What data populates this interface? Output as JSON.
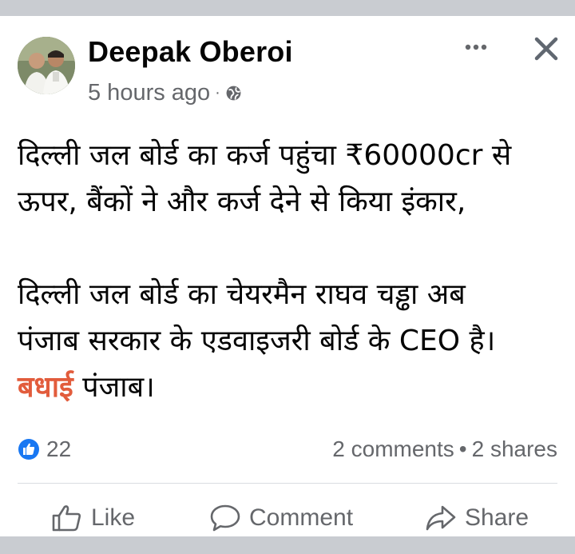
{
  "post": {
    "author": "Deepak Oberoi",
    "timestamp": "5 hours ago",
    "separator": "·",
    "privacy_icon": "globe-icon",
    "menu_icon": "more-icon",
    "close_icon": "close-icon",
    "lines": [
      "दिल्ली जल बोर्ड का कर्ज पहुंचा ₹60000cr से",
      "ऊपर, बैंकों ने और कर्ज देने से किया इंकार,",
      "दिल्ली जल बोर्ड का चेयरमैन राघव चड्ढा अब",
      "पंजाब सरकार के एडवाइजरी बोर्ड के CEO है।"
    ],
    "highlight_word": "बधाई",
    "last_line_rest": " पंजाब।",
    "highlight_color": "#e25c3c"
  },
  "engagement": {
    "reaction_count": "22",
    "comments": "2 comments",
    "dot": "•",
    "shares": "2 shares"
  },
  "actions": {
    "like_label": "Like",
    "comment_label": "Comment",
    "share_label": "Share"
  },
  "colors": {
    "band": "#c9ccd1",
    "secondary_text": "#65676b",
    "like_blue": "#1877f2"
  }
}
